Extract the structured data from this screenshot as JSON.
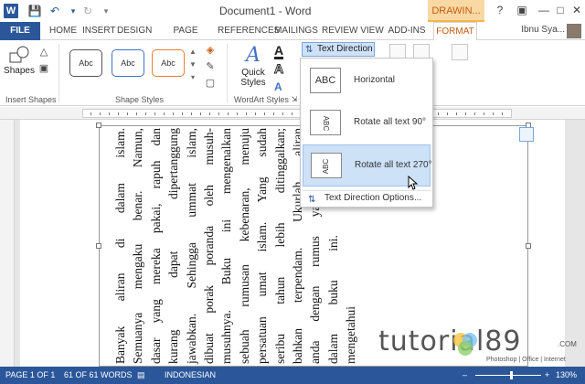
{
  "window": {
    "title": "Document1 - Word",
    "contextual_tab": "DRAWIN...",
    "help": "?"
  },
  "tabs": {
    "file": "FILE",
    "items": [
      "HOME",
      "INSERT",
      "DESIGN",
      "PAGE LAYOUT",
      "REFERENCES",
      "MAILINGS",
      "REVIEW",
      "VIEW",
      "ADD-INS"
    ],
    "format": "FORMAT",
    "user": "Ibnu Sya..."
  },
  "ribbon": {
    "shapes_label": "Shapes",
    "insert_shapes_label": "Insert Shapes",
    "shape_styles_label": "Shape Styles",
    "style_samples": [
      "Abc",
      "Abc",
      "Abc"
    ],
    "quick_styles_label_1": "Quick",
    "quick_styles_label_2": "Styles",
    "wordart_label": "WordArt Styles",
    "text_direction_label": "Text Direction"
  },
  "dropdown": {
    "items": [
      {
        "thumb": "ABC",
        "label": "Horizontal"
      },
      {
        "thumb": "ABC",
        "label": "Rotate all text 90°"
      },
      {
        "thumb": "ABC",
        "label": "Rotate all text 270°"
      }
    ],
    "options_label": "Text Direction Options..."
  },
  "document": {
    "lines": [
      "Banyak aliran di dalam islam.",
      "Semuanya mengaku benar. Namun,",
      "dasar yang mereka pakai, rapuh dan",
      "kurang  dapat  dipertanggung",
      "jawabkan. Sehingga ummat islam,",
      "dibuat porak poranda oleh musuh-",
      "musuhnya. Buku ini mengenalkan",
      "sebuah rumusan kebenaran, menuju",
      "persatuan umat islam. Yang sudah",
      "seribu tahun lebih ditinggalkan;",
      "bahkan terpendam. Ukurlah aliran",
      "anda dengan rumus yang ada di",
      "dalam buku ini. Anda akan",
      "mengetahui jawabannya"
    ]
  },
  "status": {
    "page": "PAGE 1 OF 1",
    "words": "61 OF 61 WORDS",
    "language": "INDONESIAN",
    "zoom": "130%"
  },
  "watermark": {
    "text": "tutorial89",
    "sub": "Photoshop | Office | Internet",
    "com": ".COM"
  },
  "colors": {
    "accent": "#2b579a",
    "format_tab": "#c55a11",
    "hover": "#cde1f7"
  }
}
